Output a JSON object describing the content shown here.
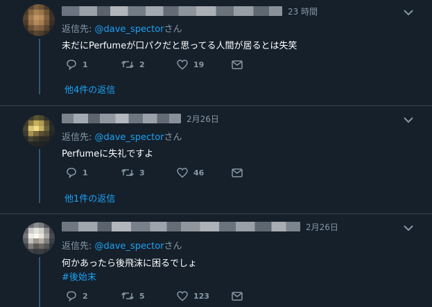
{
  "tweets": [
    {
      "time": "23 時間",
      "reply_prefix": "返信先: ",
      "reply_mention": "@dave_spector",
      "reply_suffix": "さん",
      "text": "未だにPerfumeが口パクだと思ってる人間が居るとは失笑",
      "hashtag": "",
      "replies": "1",
      "retweets": "2",
      "likes": "19",
      "more_replies": "他4件の返信"
    },
    {
      "time": "2月26日",
      "reply_prefix": "返信先: ",
      "reply_mention": "@dave_spector",
      "reply_suffix": "さん",
      "text": "Perfumeに失礼ですよ",
      "hashtag": "",
      "replies": "1",
      "retweets": "3",
      "likes": "46",
      "more_replies": "他1件の返信"
    },
    {
      "time": "2月26日",
      "reply_prefix": "返信先: ",
      "reply_mention": "@dave_spector",
      "reply_suffix": "さん",
      "text": "何かあったら後飛沫に困るでしょ",
      "hashtag": "#後始末",
      "replies": "2",
      "retweets": "5",
      "likes": "123",
      "more_replies": ""
    }
  ],
  "colors": {
    "background": "#15202b",
    "divider": "#38444d",
    "link": "#1da1f2",
    "muted": "#8899a6",
    "text": "#ffffff"
  },
  "icons": [
    "reply-icon",
    "retweet-icon",
    "like-icon",
    "dm-icon",
    "caret-down-icon"
  ]
}
